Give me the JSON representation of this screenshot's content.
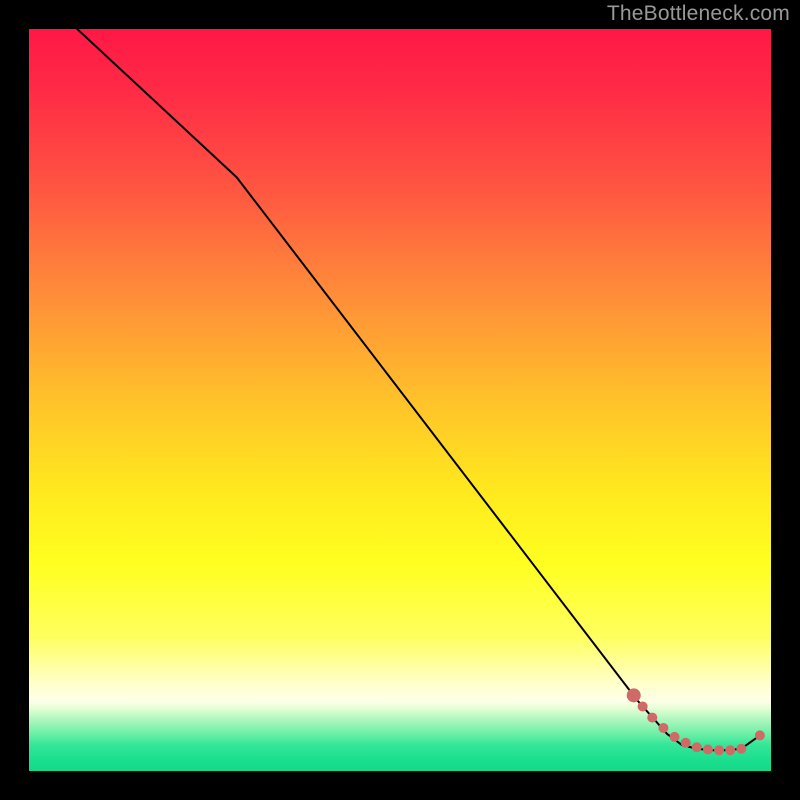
{
  "watermark": "TheBottleneck.com",
  "chart_data": {
    "type": "line",
    "title": "",
    "xlabel": "",
    "ylabel": "",
    "xlim": [
      0,
      100
    ],
    "ylim": [
      0,
      100
    ],
    "curve": {
      "x": [
        6.5,
        28,
        82,
        86,
        88,
        90,
        92,
        94,
        96,
        98.5
      ],
      "y": [
        100,
        80,
        9.5,
        5,
        3.5,
        3,
        2.8,
        2.8,
        3,
        4.8
      ]
    },
    "dots": {
      "x": [
        81.5,
        82.7,
        84,
        85.5,
        87,
        88.5,
        90,
        91.5,
        93,
        94.5,
        96,
        98.5
      ],
      "y": [
        10.2,
        8.7,
        7.2,
        5.8,
        4.6,
        3.8,
        3.2,
        2.9,
        2.8,
        2.8,
        3.0,
        4.8
      ],
      "size_first": 7,
      "size_rest": 5
    },
    "gradient_stops": [
      {
        "offset": 0.0,
        "color": "#ff1846"
      },
      {
        "offset": 0.08,
        "color": "#ff2a46"
      },
      {
        "offset": 0.2,
        "color": "#ff5042"
      },
      {
        "offset": 0.35,
        "color": "#ff8a3a"
      },
      {
        "offset": 0.5,
        "color": "#ffc22a"
      },
      {
        "offset": 0.62,
        "color": "#ffe81e"
      },
      {
        "offset": 0.72,
        "color": "#ffff20"
      },
      {
        "offset": 0.82,
        "color": "#ffff60"
      },
      {
        "offset": 0.88,
        "color": "#ffffc8"
      },
      {
        "offset": 0.905,
        "color": "#ffffe8"
      },
      {
        "offset": 0.915,
        "color": "#e6ffd6"
      },
      {
        "offset": 0.93,
        "color": "#b0f7bf"
      },
      {
        "offset": 0.95,
        "color": "#6cefa6"
      },
      {
        "offset": 0.965,
        "color": "#34e698"
      },
      {
        "offset": 0.985,
        "color": "#1adf8f"
      },
      {
        "offset": 1.0,
        "color": "#14d989"
      }
    ],
    "dot_color": "#cf6a67",
    "line_color": "#000000"
  }
}
